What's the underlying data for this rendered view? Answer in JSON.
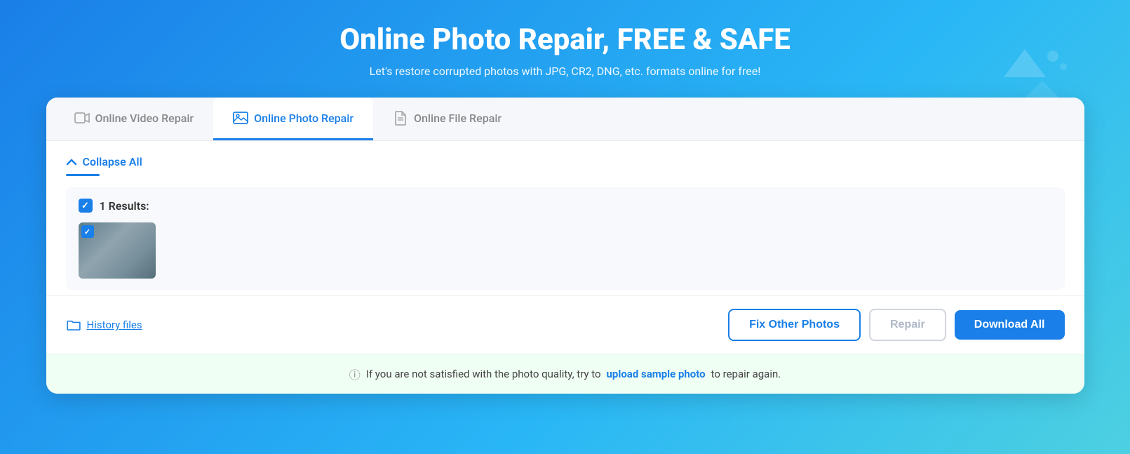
{
  "header": {
    "title": "Online Photo Repair, FREE & SAFE",
    "subtitle": "Let's restore corrupted photos with JPG, CR2, DNG, etc. formats online for free!"
  },
  "tabs": [
    {
      "id": "video",
      "label": "Online Video Repair",
      "icon": "video-icon",
      "active": false
    },
    {
      "id": "photo",
      "label": "Online Photo Repair",
      "icon": "photo-icon",
      "active": true
    },
    {
      "id": "file",
      "label": "Online File Repair",
      "icon": "file-icon",
      "active": false
    }
  ],
  "content": {
    "collapse_label": "Collapse All",
    "results_count": "1 Results:",
    "history_label": "History files",
    "buttons": {
      "fix_other": "Fix Other Photos",
      "repair": "Repair",
      "download_all": "Download All"
    },
    "notice": {
      "prefix": "If you are not satisfied with the photo quality, try to",
      "link_text": "upload sample photo",
      "suffix": "to repair again."
    }
  }
}
